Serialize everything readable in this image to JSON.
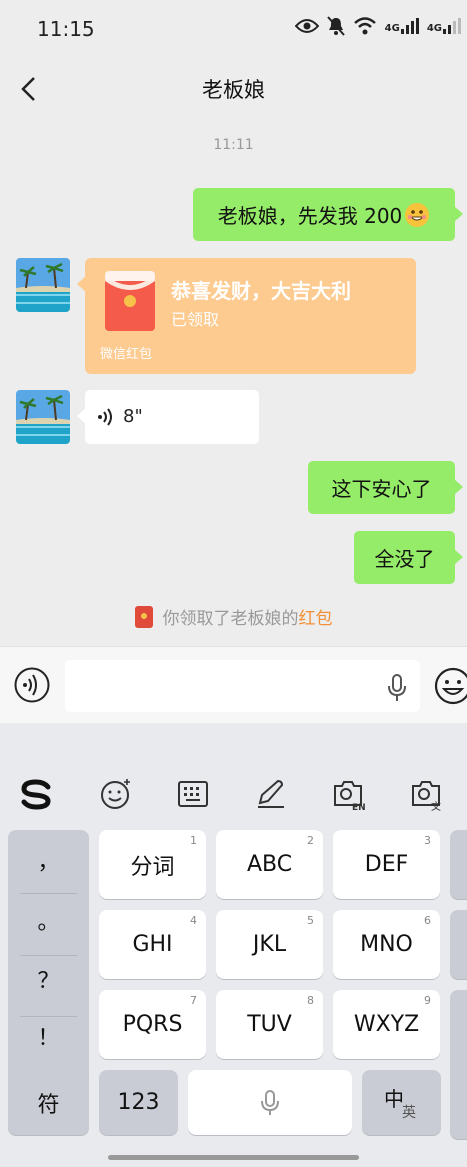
{
  "status_bar": {
    "time": "11:15",
    "network_1": "4G",
    "network_2": "4G"
  },
  "header": {
    "title": "老板娘"
  },
  "chat": {
    "timestamp": "11:11",
    "messages": [
      {
        "text": "老板娘，先发我 200"
      },
      {
        "red_packet": {
          "title": "恭喜发财，大吉大利",
          "status": "已领取",
          "footer": "微信红包"
        }
      },
      {
        "voice_duration": "8\""
      },
      {
        "text": "这下安心了"
      },
      {
        "text": "全没了"
      }
    ],
    "system_note": {
      "prefix": "你领取了老板娘的",
      "highlight": "红包"
    },
    "colors": {
      "bubble_green": "#95ec69",
      "red_packet": "#fdca8f",
      "highlight": "#f19036"
    }
  },
  "input_bar": {
    "voice_icon": "voice-toggle-icon",
    "mic_icon": "mic-icon",
    "emoji_icon": "emoji-icon"
  },
  "keyboard": {
    "toolbar": [
      "sogou-logo-icon",
      "emoji-face-icon",
      "keyboard-icon",
      "handwriting-icon",
      "camera-en-icon",
      "camera-translate-icon"
    ],
    "punctuation": [
      "，",
      "。",
      "？",
      "！"
    ],
    "keys": [
      {
        "label": "分词",
        "sub": "1"
      },
      {
        "label": "ABC",
        "sub": "2"
      },
      {
        "label": "DEF",
        "sub": "3"
      },
      {
        "label": "GHI",
        "sub": "4"
      },
      {
        "label": "JKL",
        "sub": "5"
      },
      {
        "label": "MNO",
        "sub": "6"
      },
      {
        "label": "PQRS",
        "sub": "7"
      },
      {
        "label": "TUV",
        "sub": "8"
      },
      {
        "label": "WXYZ",
        "sub": "9"
      }
    ],
    "bottom": {
      "symbol": "符",
      "numbers": "123",
      "lang_main": "中",
      "lang_sub": "英"
    }
  }
}
